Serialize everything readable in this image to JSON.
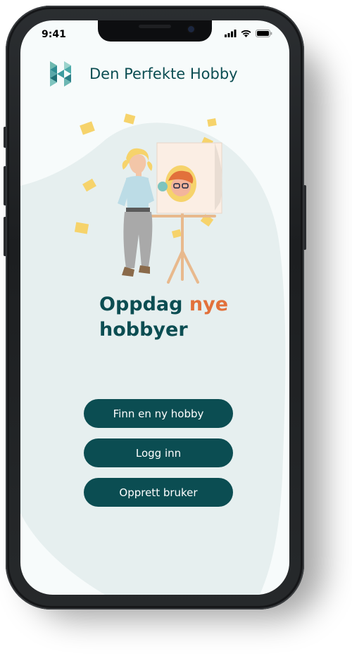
{
  "status_bar": {
    "time": "9:41",
    "icons": [
      "cellular-signal-icon",
      "wifi-icon",
      "battery-icon"
    ]
  },
  "header": {
    "brand_name": "Den Perfekte Hobby",
    "logo_icon": "hobby-logo-icon"
  },
  "hero": {
    "illustration_icon": "woman-painting-easel-illustration",
    "headline_part1": "Oppdag ",
    "headline_accent": "nye",
    "headline_part2": "hobbyer"
  },
  "actions": {
    "find_hobby_label": "Finn en ny hobby",
    "login_label": "Logg inn",
    "register_label": "Opprett bruker"
  },
  "colors": {
    "primary": "#0b4d52",
    "accent": "#e2713b",
    "background": "#f7fbfb",
    "blob": "#e6efef",
    "button_text": "#ffffff"
  }
}
